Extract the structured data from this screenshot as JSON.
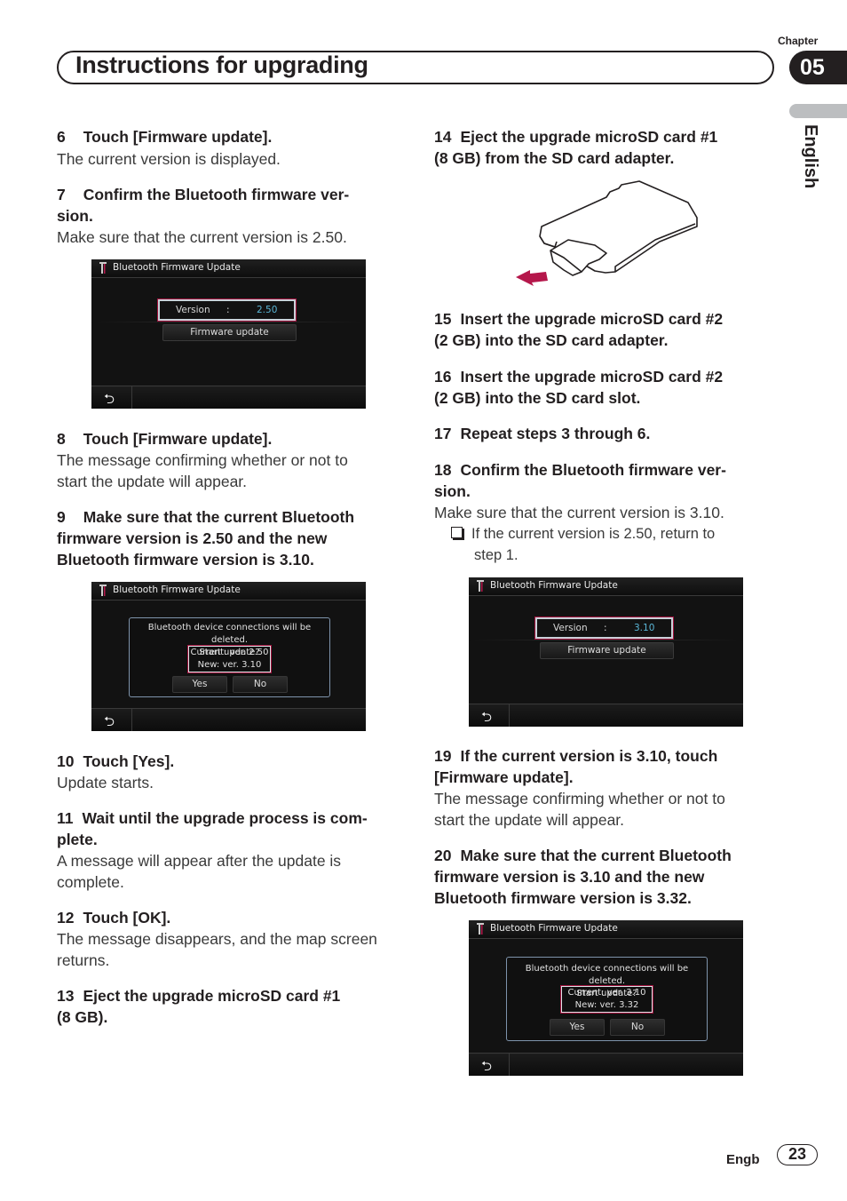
{
  "header": {
    "chapter_label": "Chapter",
    "chapter_number": "05",
    "title": "Instructions for upgrading",
    "language_tab": "English"
  },
  "left_column": {
    "step6": {
      "num": "6",
      "title": "Touch [Firmware update].",
      "body": "The current version is displayed."
    },
    "step7": {
      "num": "7",
      "title_line1": "Confirm the Bluetooth firmware ver-",
      "title_line2": "sion.",
      "body": "Make sure that the current version is 2.50."
    },
    "screen1": {
      "header_title": "Bluetooth Firmware Update",
      "version_label": "Version",
      "version_colon": ":",
      "version_value": "2.50",
      "firmware_button": "Firmware update",
      "back_icon": "back-arrow-icon"
    },
    "step8": {
      "num": "8",
      "title": "Touch [Firmware update].",
      "body_line1": "The message confirming whether or not to",
      "body_line2": "start the update will appear."
    },
    "step9": {
      "num": "9",
      "title_line1": "Make sure that the current Bluetooth",
      "title_line2": "firmware version is 2.50 and the new",
      "title_line3": "Bluetooth firmware version is 3.10."
    },
    "screen2": {
      "header_title": "Bluetooth Firmware Update",
      "message_line1": "Bluetooth device connections will be deleted.",
      "message_line2": "Start update?",
      "current": "Current: ver. 2.50",
      "new": "New: ver. 3.10",
      "yes_button": "Yes",
      "no_button": "No"
    },
    "step10": {
      "num": "10",
      "title": "Touch [Yes].",
      "body": "Update starts."
    },
    "step11": {
      "num": "11",
      "title_line1": "Wait until the upgrade process is com-",
      "title_line2": "plete.",
      "body_line1": "A message will appear after the update is",
      "body_line2": "complete."
    },
    "step12": {
      "num": "12",
      "title": "Touch [OK].",
      "body_line1": "The message disappears, and the map screen",
      "body_line2": "returns."
    },
    "step13": {
      "num": "13",
      "title_line1": "Eject the upgrade microSD card #1",
      "title_line2": "(8 GB)."
    }
  },
  "right_column": {
    "step14": {
      "num": "14",
      "title_line1": "Eject the upgrade microSD card #1",
      "title_line2": "(8 GB) from the SD card adapter."
    },
    "illustration": {
      "description": "microSD card ejected from SD card adapter",
      "arrow_color": "#b5174b"
    },
    "step15": {
      "num": "15",
      "title_line1": "Insert the upgrade microSD card #2",
      "title_line2": "(2 GB) into the SD card adapter."
    },
    "step16": {
      "num": "16",
      "title_line1": "Insert the upgrade microSD card #2",
      "title_line2": "(2 GB) into the SD card slot."
    },
    "step17": {
      "num": "17",
      "title": "Repeat steps 3 through 6."
    },
    "step18": {
      "num": "18",
      "title_line1": "Confirm the Bluetooth firmware ver-",
      "title_line2": "sion.",
      "body": "Make sure that the current version is 3.10.",
      "note_line1": "If the current version is 2.50, return to",
      "note_line2": "step 1."
    },
    "screen3": {
      "header_title": "Bluetooth Firmware Update",
      "version_label": "Version",
      "version_colon": ":",
      "version_value": "3.10",
      "firmware_button": "Firmware update"
    },
    "step19": {
      "num": "19",
      "title_line1": "If the current version is 3.10, touch",
      "title_line2": "[Firmware update].",
      "body_line1": "The message confirming whether or not to",
      "body_line2": "start the update will appear."
    },
    "step20": {
      "num": "20",
      "title_line1": "Make sure that the current Bluetooth",
      "title_line2": "firmware version is 3.10 and the new",
      "title_line3": "Bluetooth firmware version is 3.32."
    },
    "screen4": {
      "header_title": "Bluetooth Firmware Update",
      "message_line1": "Bluetooth device connections will be deleted.",
      "message_line2": "Start update?",
      "current": "Current: ver. 3.10",
      "new": "New: ver. 3.32",
      "yes_button": "Yes",
      "no_button": "No"
    }
  },
  "footer": {
    "language_code": "Engb",
    "page_number": "23"
  },
  "colors": {
    "highlight_border": "#a0123c",
    "version_value": "#5ab6d6",
    "dialog_border": "#7e93ab",
    "text": "#231f20"
  }
}
